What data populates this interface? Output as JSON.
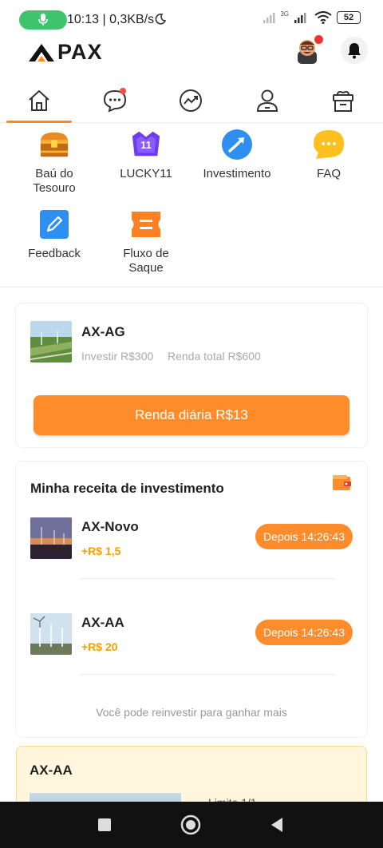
{
  "status_bar": {
    "time_speed": "10:13 | 0,3KB/s",
    "net_label": "3G",
    "battery": "52"
  },
  "header": {
    "logo_text": "PAX"
  },
  "tabs": [
    {
      "name": "home-icon"
    },
    {
      "name": "chat-icon"
    },
    {
      "name": "chart-icon"
    },
    {
      "name": "user-icon"
    },
    {
      "name": "gift-icon"
    }
  ],
  "quick_menu": {
    "items": [
      {
        "label": "Baú do\nTesouro",
        "icon": "treasure-chest-icon"
      },
      {
        "label": "LUCKY11",
        "icon": "lucky-badge-icon",
        "badge": "11"
      },
      {
        "label": "Investimento",
        "icon": "investment-arrow-icon"
      },
      {
        "label": "FAQ",
        "icon": "faq-bubble-icon"
      },
      {
        "label": "Feedback",
        "icon": "feedback-pen-icon"
      },
      {
        "label": "Fluxo de\nSaque",
        "icon": "withdraw-flow-icon"
      }
    ]
  },
  "product": {
    "name": "AX-AG",
    "invest": "Investir R$300",
    "total": "Renda total R$600",
    "button": "Renda diária R$13"
  },
  "income": {
    "title": "Minha receita de investimento",
    "rows": [
      {
        "name": "AX-Novo",
        "gain": "+R$ 1,5",
        "after": "Depois 14:26:43"
      },
      {
        "name": "AX-AA",
        "gain": "+R$ 20",
        "after": "Depois 14:26:43"
      }
    ],
    "note": "Você pode reinvestir para ganhar mais"
  },
  "bottom_card": {
    "title": "AX-AA",
    "partial": "Limite 1/1"
  },
  "colors": {
    "accent": "#ff8c2a",
    "gain": "#f6a000",
    "underline": "#ff8a1a"
  }
}
